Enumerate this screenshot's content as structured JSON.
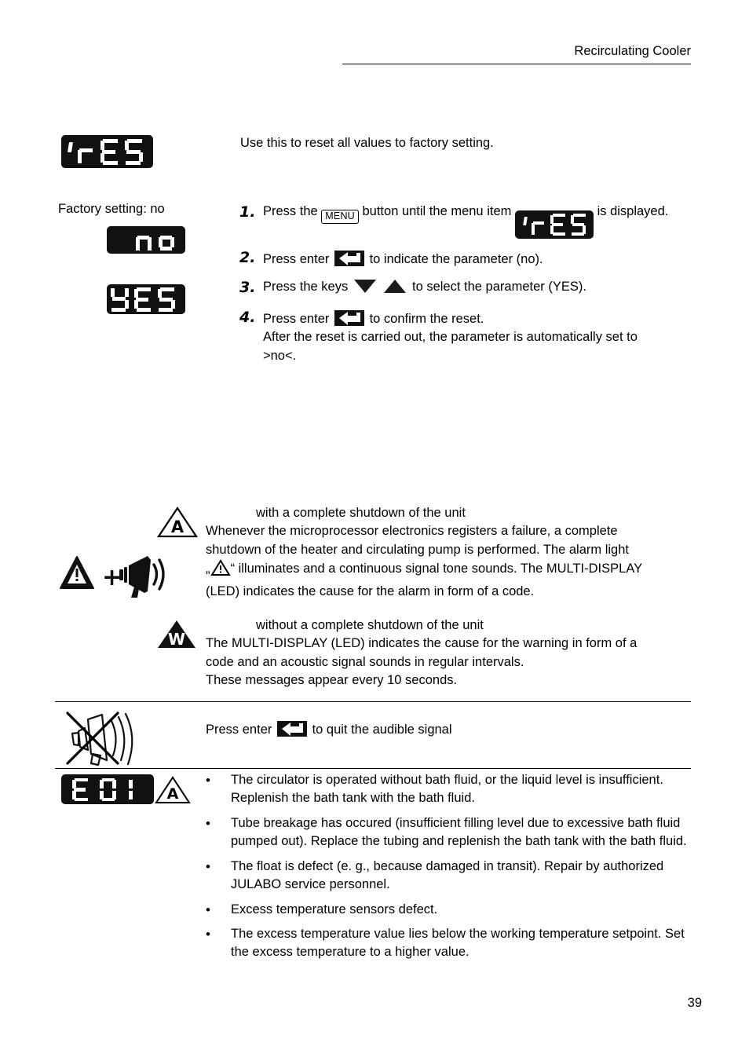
{
  "header": {
    "title": "Recirculating Cooler"
  },
  "reset_section": {
    "display_label": "rES",
    "intro": "Use this to reset all values to factory setting.",
    "factory_setting": "Factory setting: no",
    "display_no": "no",
    "display_yes": "YES",
    "steps": [
      {
        "num": "1.",
        "text_before": "Press the",
        "key": "MENU",
        "text_mid": "button until the menu item",
        "display": "rES",
        "text_after": "is displayed."
      },
      {
        "num": "2.",
        "text_before": "Press enter",
        "key": "enter-key",
        "text_after": "to indicate the parameter (no)."
      },
      {
        "num": "3.",
        "text_before": "Press the keys",
        "key": "down-up-keys",
        "text_after": "to select the parameter (YES)."
      },
      {
        "num": "4.",
        "text_before": "Press enter",
        "key": "enter-key",
        "text_after": "to confirm the reset.",
        "extra_line_1": "After the reset is carried out, the parameter is automatically set to",
        "extra_line_2": ">no<."
      }
    ]
  },
  "alarm": {
    "symbol": "A",
    "heading": "with a complete shutdown of the unit",
    "para_line_1": "Whenever the microprocessor electronics registers a failure, a complete",
    "para_line_2": "shutdown of the heater and circulating pump is performed. The alarm light",
    "quote_open": "„",
    "quote_close": "“",
    "para_line_3_after": " illuminates and a continuous signal tone sounds. The MULTI-DISPLAY",
    "para_line_4": "(LED) indicates the cause for the alarm in form of a code."
  },
  "warning": {
    "symbol": "W",
    "heading": "without a complete shutdown of the unit",
    "para_line_1": "The MULTI-DISPLAY (LED) indicates the cause for the warning in form of a",
    "para_line_2": "code and an acoustic signal sounds in regular intervals.",
    "para_line_3": "These messages appear every 10 seconds."
  },
  "audible": {
    "text_before": "Press enter",
    "text_after": "to quit the audible signal"
  },
  "error": {
    "code_display": "E 01",
    "symbol": "A",
    "causes": [
      "The circulator is operated without bath fluid, or the liquid level is insufficient. Replenish the bath tank with the bath fluid.",
      "Tube breakage has occured (insufficient filling level due to excessive bath fluid pumped out). Replace the tubing and replenish the bath tank with the bath fluid.",
      "The float is defect (e. g., because damaged in transit). Repair by authorized JULABO service personnel.",
      "Excess temperature sensors defect.",
      "The excess temperature value lies below the working temperature setpoint. Set the excess temperature to a higher value."
    ],
    "bullet_glyph": "•"
  },
  "footer": {
    "page_number": "39"
  },
  "colors": {
    "led_background": "#111111",
    "led_segment": "#ffffff",
    "ink": "#000000"
  }
}
